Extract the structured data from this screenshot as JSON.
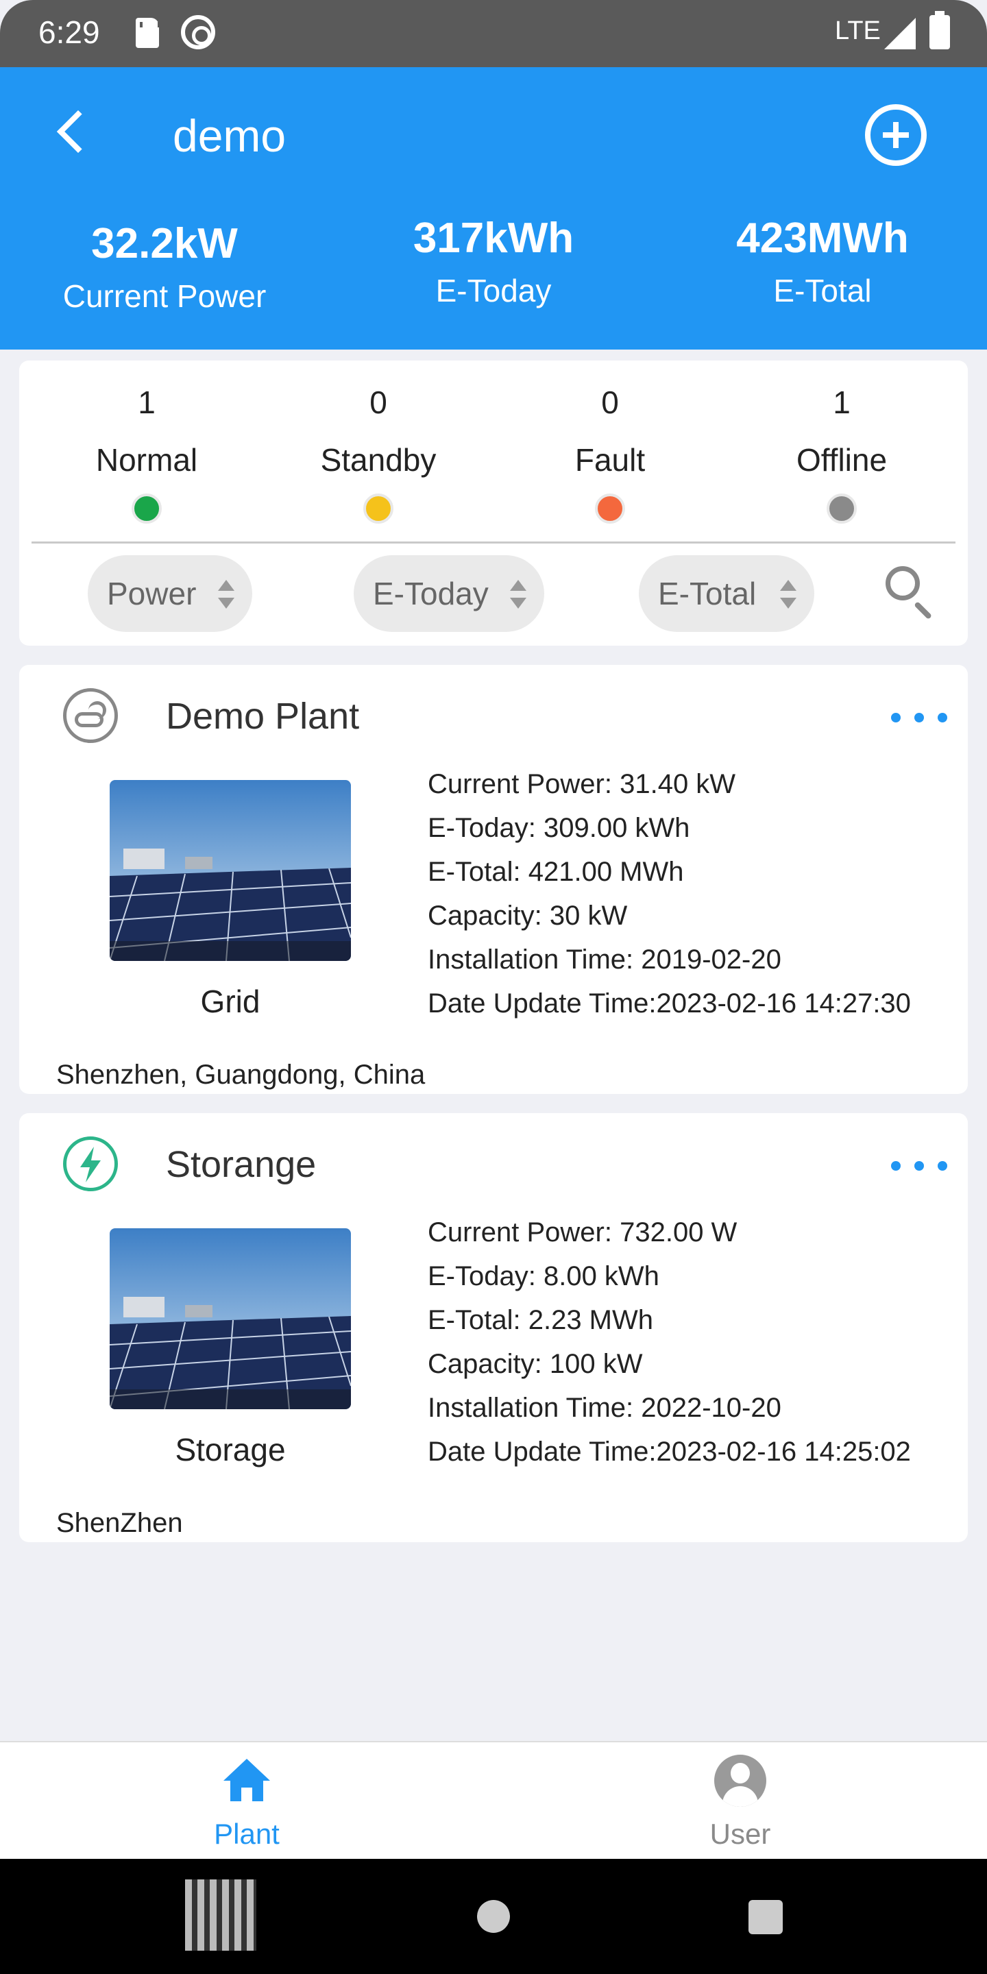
{
  "status_bar": {
    "time": "6:29",
    "network": "LTE"
  },
  "header": {
    "title": "demo"
  },
  "summary": [
    {
      "value": "32.2kW",
      "label": "Current Power"
    },
    {
      "value": "317kWh",
      "label": "E-Today"
    },
    {
      "value": "423MWh",
      "label": "E-Total"
    }
  ],
  "status_counts": [
    {
      "count": "1",
      "label": "Normal",
      "color": "#1aa64a"
    },
    {
      "count": "0",
      "label": "Standby",
      "color": "#f5c21b"
    },
    {
      "count": "0",
      "label": "Fault",
      "color": "#f4683d"
    },
    {
      "count": "1",
      "label": "Offline",
      "color": "#8a8a8a"
    }
  ],
  "sort_buttons": [
    {
      "label": "Power"
    },
    {
      "label": "E-Today"
    },
    {
      "label": "E-Total"
    }
  ],
  "plants": [
    {
      "name": "Demo Plant",
      "icon": "weather-icon",
      "type": "Grid",
      "details": [
        "Current Power: 31.40 kW",
        "E-Today: 309.00 kWh",
        "E-Total: 421.00 MWh",
        "Capacity: 30 kW",
        "Installation Time: 2019-02-20",
        "Date Update Time:2023-02-16 14:27:30"
      ],
      "location": "Shenzhen, Guangdong, China"
    },
    {
      "name": "Storange",
      "icon": "bolt-icon",
      "type": "Storage",
      "details": [
        "Current Power: 732.00 W",
        "E-Today: 8.00 kWh",
        "E-Total: 2.23 MWh",
        "Capacity: 100 kW",
        "Installation Time: 2022-10-20",
        "Date Update Time:2023-02-16 14:25:02"
      ],
      "location": "ShenZhen"
    }
  ],
  "bottom_nav": [
    {
      "label": "Plant",
      "active": true,
      "color": "#2196f3"
    },
    {
      "label": "User",
      "active": false,
      "color": "#8a8a8a"
    }
  ]
}
